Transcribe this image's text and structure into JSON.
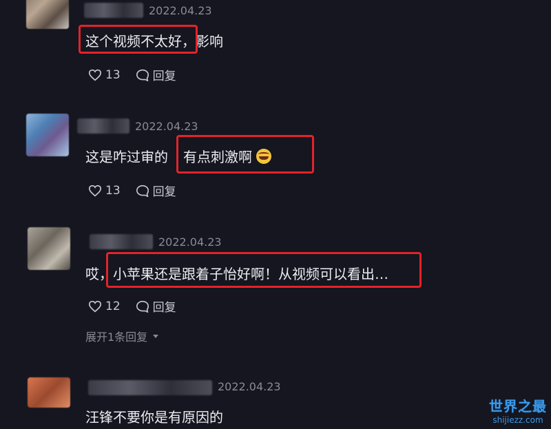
{
  "comments": [
    {
      "date": "2022.04.23",
      "text_highlighted": "这个视频不太好，",
      "text_rest": "影响",
      "likes": "13",
      "reply_label": "回复"
    },
    {
      "date": "2022.04.23",
      "text_prefix": "这是咋过审的",
      "text_highlighted": "有点刺激啊",
      "likes": "13",
      "reply_label": "回复"
    },
    {
      "date": "2022.04.23",
      "text_prefix": "哎，",
      "text_highlighted": "小苹果还是跟着子怡好啊！从视频可以看出…",
      "likes": "12",
      "reply_label": "回复",
      "expand_label": "展开1条回复"
    },
    {
      "date": "2022.04.23",
      "text": "汪锋不要你是有原因的"
    }
  ],
  "watermark": {
    "title": "世界之最",
    "url": "shijiezz.com",
    "color": "#3d9ae8"
  },
  "colors": {
    "background": "#15161f",
    "highlight": "#e4232a"
  }
}
